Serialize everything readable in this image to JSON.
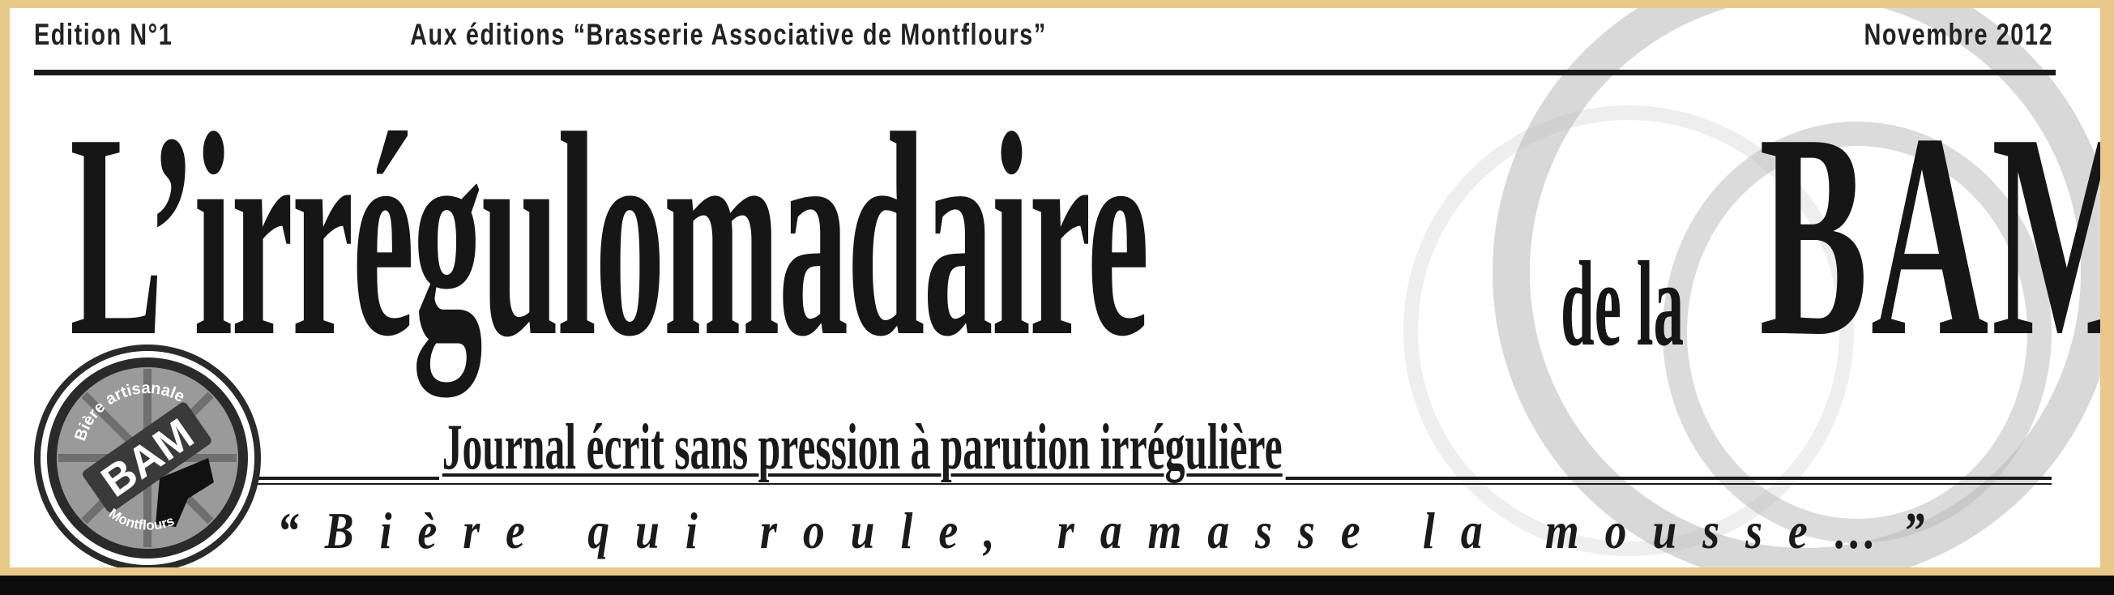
{
  "header": {
    "edition": "Edition N°1",
    "publisher": "Aux éditions “Brasserie Associative de Montflours”",
    "date": "Novembre 2012"
  },
  "masthead": {
    "title_main": "L’irrégulomadaire",
    "title_connector": "de la",
    "title_brand": "BAM"
  },
  "subtitle": "Journal écrit sans pression à parution irrégulière",
  "motto": "“Bière qui roule, ramasse la mousse…”",
  "seal": {
    "top_text": "Bière artisanale",
    "center_text": "BAM",
    "bottom_text": "Montflours"
  }
}
